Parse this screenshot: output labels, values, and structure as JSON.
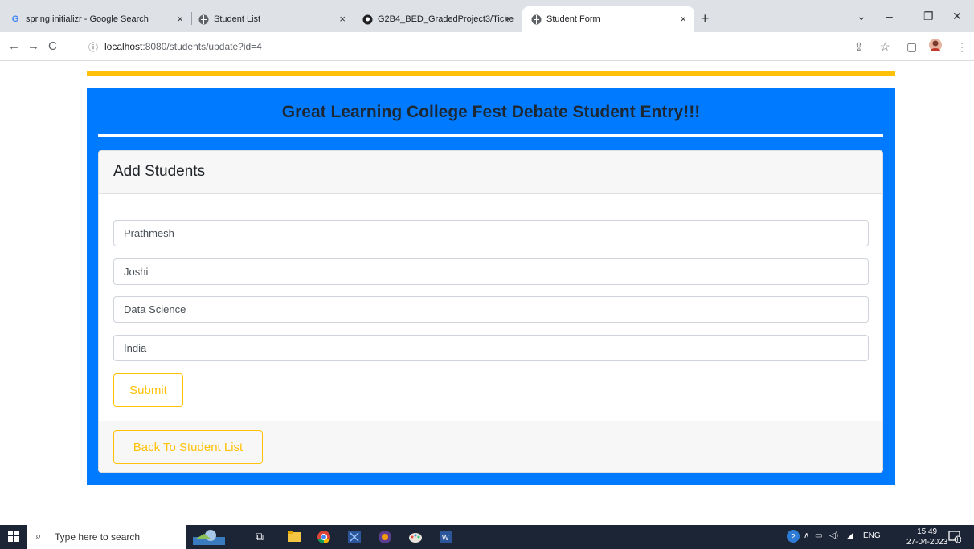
{
  "browser": {
    "tabs": [
      {
        "title": "spring initializr - Google Search",
        "icon": "google-icon"
      },
      {
        "title": "Student List",
        "icon": "globe-icon"
      },
      {
        "title": "G2B4_BED_GradedProject3/Ticke",
        "icon": "github-icon"
      },
      {
        "title": "Student Form",
        "icon": "globe-icon",
        "active": true
      }
    ],
    "url_host": "localhost",
    "url_path": ":8080/students/update?id=4"
  },
  "page": {
    "heading": "Great Learning College Fest Debate Student Entry!!!",
    "card_title": "Add Students",
    "fields": {
      "first_name": "Prathmesh",
      "last_name": "Joshi",
      "department": "Data Science",
      "country": "India"
    },
    "submit_label": "Submit",
    "back_label": "Back To Student List"
  },
  "colors": {
    "accent_blue": "#007bff",
    "accent_yellow": "#ffc107"
  },
  "taskbar": {
    "search_placeholder": "Type here to search",
    "language": "ENG",
    "time": "15:49",
    "date": "27-04-2023",
    "notification_count": "8"
  }
}
